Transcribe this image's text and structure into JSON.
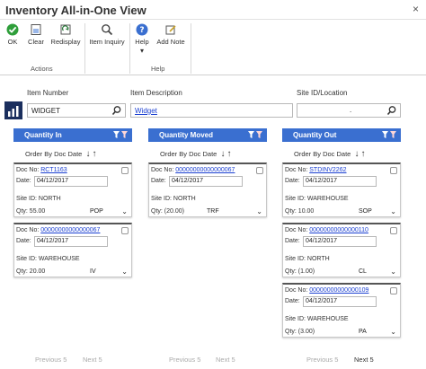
{
  "window": {
    "title": "Inventory All-in-One View",
    "close": "×"
  },
  "ribbon": {
    "buttons": {
      "ok": "OK",
      "clear": "Clear",
      "redisplay": "Redisplay",
      "item_inquiry": "Item Inquiry",
      "help": "Help",
      "add_note": "Add Note"
    },
    "help_dropdown": "▾",
    "groups": {
      "actions": "Actions",
      "help": "Help"
    }
  },
  "filters": {
    "item_number_label": "Item Number",
    "item_number_value": "WIDGET",
    "item_description_label": "Item Description",
    "item_description_value": "Widget",
    "site_label": "Site ID/Location",
    "site_value": "."
  },
  "columns": {
    "in": {
      "title": "Quantity In",
      "order_label": "Order By Doc Date",
      "cards": [
        {
          "doc_label": "Doc No:",
          "doc_no": "RCT1163",
          "date_label": "Date:",
          "date": "04/12/2017",
          "site_label": "Site ID:",
          "site": "NORTH",
          "qty_label": "Qty:",
          "qty": "55.00",
          "source": "POP"
        },
        {
          "doc_label": "Doc No:",
          "doc_no": "00000000000000067",
          "date_label": "Date:",
          "date": "04/12/2017",
          "site_label": "Site ID:",
          "site": "WAREHOUSE",
          "qty_label": "Qty:",
          "qty": "20.00",
          "source": "IV"
        }
      ],
      "prev": "Previous 5",
      "next": "Next 5"
    },
    "moved": {
      "title": "Quantity Moved",
      "order_label": "Order By Doc Date",
      "cards": [
        {
          "doc_label": "Doc No:",
          "doc_no": "00000000000000067",
          "date_label": "Date:",
          "date": "04/12/2017",
          "site_label": "Site ID:",
          "site": "NORTH",
          "qty_label": "Qty:",
          "qty": "(20.00)",
          "source": "TRF"
        }
      ],
      "prev": "Previous 5",
      "next": "Next 5"
    },
    "out": {
      "title": "Quantity Out",
      "order_label": "Order By Doc Date",
      "cards": [
        {
          "doc_label": "Doc No:",
          "doc_no": "STDINV2262",
          "date_label": "Date:",
          "date": "04/12/2017",
          "site_label": "Site ID:",
          "site": "WAREHOUSE",
          "qty_label": "Qty:",
          "qty": "10.00",
          "source": "SOP"
        },
        {
          "doc_label": "Doc No:",
          "doc_no": "00000000000000110",
          "date_label": "Date:",
          "date": "04/12/2017",
          "site_label": "Site ID:",
          "site": "NORTH",
          "qty_label": "Qty:",
          "qty": "(1.00)",
          "source": "CL"
        },
        {
          "doc_label": "Doc No:",
          "doc_no": "00000000000000109",
          "date_label": "Date:",
          "date": "04/12/2017",
          "site_label": "Site ID:",
          "site": "WAREHOUSE",
          "qty_label": "Qty:",
          "qty": "(3.00)",
          "source": "PA"
        }
      ],
      "prev": "Previous 5",
      "next": "Next 5"
    }
  },
  "colors": {
    "header_blue": "#3a6fd0",
    "link_blue": "#1a3fd1",
    "accent_dark": "#1b2f5e"
  }
}
